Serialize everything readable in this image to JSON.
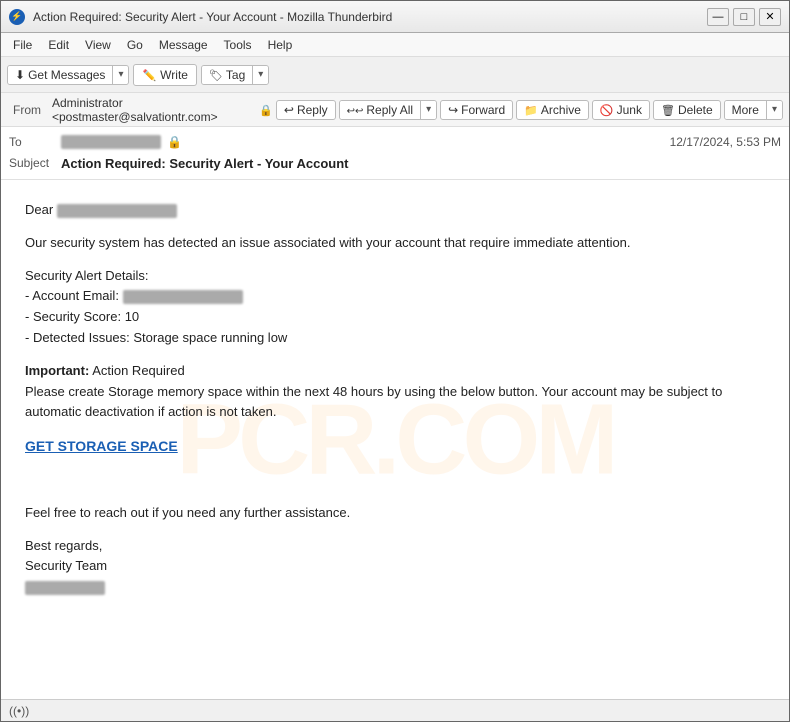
{
  "window": {
    "title": "Action Required: Security Alert - Your Account - Mozilla Thunderbird",
    "controls": {
      "minimize": "—",
      "maximize": "□",
      "close": "✕"
    }
  },
  "menubar": {
    "items": [
      "File",
      "Edit",
      "View",
      "Go",
      "Message",
      "Tools",
      "Help"
    ]
  },
  "toolbar": {
    "get_messages_label": "Get Messages",
    "write_label": "Write",
    "tag_label": "Tag"
  },
  "action_bar": {
    "from_label": "From",
    "from_value": "Administrator <postmaster@salvationtr.com>",
    "reply_label": "Reply",
    "reply_all_label": "Reply All",
    "forward_label": "Forward",
    "archive_label": "Archive",
    "junk_label": "Junk",
    "delete_label": "Delete",
    "more_label": "More"
  },
  "email_header": {
    "to_label": "To",
    "subject_label": "Subject",
    "subject_value": "Action Required: Security Alert - Your Account",
    "date_value": "12/17/2024, 5:53 PM"
  },
  "email_body": {
    "greeting": "Dear",
    "intro": "Our security system has detected an issue associated with your account that require immediate attention.",
    "alert_heading": "Security Alert Details:",
    "alert_item1": "- Account Email:",
    "alert_item2": "- Security Score: 10",
    "alert_item3": "- Detected Issues: Storage space running low",
    "important_label": "Important:",
    "important_text": " Action Required",
    "body_text": "Please create Storage memory space within the next 48 hours by using the below button. Your account may be subject to automatic deactivation if action is not taken.",
    "cta_label": "GET STORAGE SPACE",
    "footer1": "Feel free to reach out if you need any further assistance.",
    "footer2": "Best regards,",
    "footer3": "Security Team"
  },
  "status_bar": {
    "icon": "((•))"
  }
}
